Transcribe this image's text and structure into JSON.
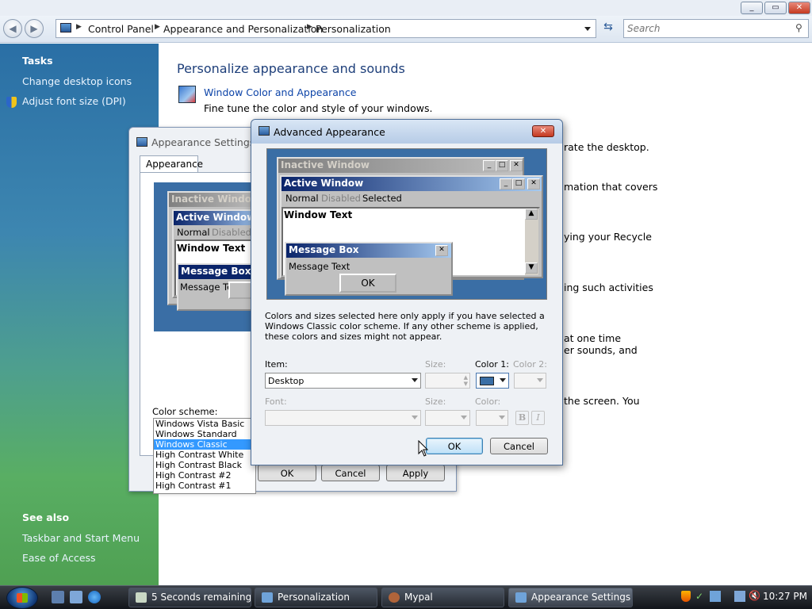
{
  "window": {
    "minimize": "_",
    "maximize": "▭",
    "close": "✕"
  },
  "nav": {
    "back": "◀",
    "forward": "▶",
    "breadcrumb": [
      "Control Panel",
      "Appearance and Personalization",
      "Personalization"
    ],
    "search_placeholder": "Search"
  },
  "sidebar": {
    "tasks_header": "Tasks",
    "tasks": [
      "Change desktop icons",
      "Adjust font size (DPI)"
    ],
    "see_also_header": "See also",
    "see_also": [
      "Taskbar and Start Menu",
      "Ease of Access"
    ]
  },
  "main": {
    "title": "Personalize appearance and sounds",
    "tasks": [
      {
        "link": "Window Color and Appearance",
        "desc": "Fine tune the color and style of your windows."
      }
    ],
    "partial_descs": [
      "rate the desktop.",
      "mation that covers",
      "ying your Recycle",
      "ing such activities",
      "at one time",
      "er sounds, and",
      "the screen. You"
    ]
  },
  "appearance_settings": {
    "title": "Appearance Settings",
    "tab": "Appearance",
    "preview": {
      "inactive": "Inactive Window",
      "active": "Active Window",
      "normal": "Normal",
      "disabled": "Disabled",
      "window_text": "Window Text",
      "message_box": "Message Box",
      "message_text": "Message Text"
    },
    "scheme_label": "Color scheme:",
    "schemes": [
      "Windows Vista Basic",
      "Windows Standard",
      "Windows Classic",
      "High Contrast White",
      "High Contrast Black",
      "High Contrast #2",
      "High Contrast #1"
    ],
    "selected_scheme": "Windows Classic",
    "ok": "OK",
    "cancel": "Cancel",
    "apply": "Apply"
  },
  "advanced": {
    "title": "Advanced Appearance",
    "preview": {
      "inactive": "Inactive Window",
      "active": "Active Window",
      "normal": "Normal",
      "disabled": "Disabled",
      "selected": "Selected",
      "window_text": "Window Text",
      "message_box": "Message Box",
      "message_text": "Message Text",
      "ok": "OK"
    },
    "note": "Colors and sizes selected here only apply if you have selected a Windows Classic color scheme. If any other scheme is applied, these colors and sizes might not appear.",
    "item_label": "Item:",
    "item_value": "Desktop",
    "size_label": "Size:",
    "color1_label": "Color 1:",
    "color2_label": "Color 2:",
    "font_label": "Font:",
    "font_size_label": "Size:",
    "font_color_label": "Color:",
    "bold": "B",
    "italic": "I",
    "color1_swatch": "#3a6ea5",
    "ok": "OK",
    "cancel": "Cancel"
  },
  "taskbar": {
    "buttons": [
      {
        "label": "5 Seconds remaining"
      },
      {
        "label": "Personalization"
      },
      {
        "label": "Mypal"
      },
      {
        "label": "Appearance Settings"
      }
    ],
    "clock": "10:27 PM"
  }
}
